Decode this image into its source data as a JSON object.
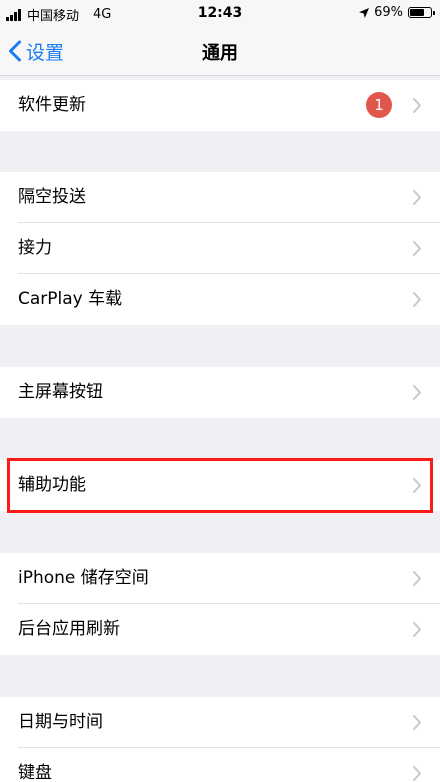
{
  "status_bar": {
    "carrier": "中国移动",
    "network": "4G",
    "time": "12:43",
    "battery": "69%",
    "battery_level": 0.69
  },
  "nav": {
    "back_label": "设置",
    "title": "通用"
  },
  "rows": {
    "software_update": {
      "label": "软件更新",
      "badge": "1"
    },
    "airdrop": {
      "label": "隔空投送"
    },
    "handoff": {
      "label": "接力"
    },
    "carplay": {
      "label": "CarPlay 车载"
    },
    "home_button": {
      "label": "主屏幕按钮"
    },
    "accessibility": {
      "label": "辅助功能"
    },
    "iphone_storage": {
      "label": "iPhone 储存空间"
    },
    "background_refresh": {
      "label": "后台应用刷新"
    },
    "date_time": {
      "label": "日期与时间"
    },
    "keyboard": {
      "label": "键盘"
    }
  },
  "colors": {
    "accent": "#1a7bf2",
    "badge": "#e2574c",
    "highlight": "#ff1a1a",
    "group_background": "#efeff4"
  },
  "icons": [
    "signal-bars-icon",
    "location-arrow-icon",
    "battery-icon",
    "back-chevron-icon",
    "chevron-right-icon"
  ]
}
